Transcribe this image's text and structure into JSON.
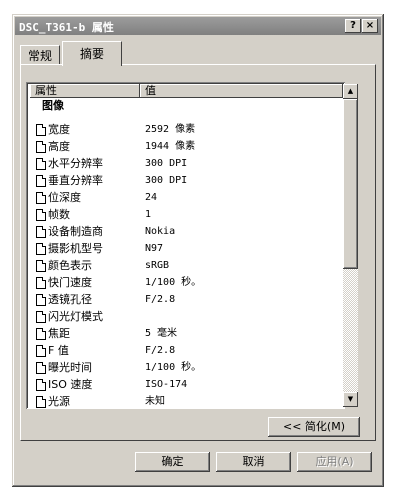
{
  "window": {
    "title": "DSC_T361-b 属性",
    "help_button": "?",
    "close_button": "×"
  },
  "tabs": [
    "常规",
    "摘要"
  ],
  "list": {
    "headers": {
      "property": "属性",
      "value": "值"
    },
    "group": "图像",
    "rows": [
      {
        "label": "宽度",
        "value": "2592 像素"
      },
      {
        "label": "高度",
        "value": "1944 像素"
      },
      {
        "label": "水平分辨率",
        "value": "300 DPI"
      },
      {
        "label": "垂直分辨率",
        "value": "300 DPI"
      },
      {
        "label": "位深度",
        "value": "24"
      },
      {
        "label": "帧数",
        "value": "1"
      },
      {
        "label": "设备制造商",
        "value": "Nokia"
      },
      {
        "label": "摄影机型号",
        "value": "N97"
      },
      {
        "label": "颜色表示",
        "value": "sRGB"
      },
      {
        "label": "快门速度",
        "value": "1/100 秒。"
      },
      {
        "label": "透镜孔径",
        "value": "F/2.8"
      },
      {
        "label": "闪光灯模式",
        "value": ""
      },
      {
        "label": "焦距",
        "value": "5 毫米"
      },
      {
        "label": "F 值",
        "value": "F/2.8"
      },
      {
        "label": "曝光时间",
        "value": "1/100 秒。"
      },
      {
        "label": "ISO 速度",
        "value": "ISO-174"
      },
      {
        "label": "光源",
        "value": "未知"
      }
    ]
  },
  "buttons": {
    "simplify": "<< 简化(M)",
    "ok": "确定",
    "cancel": "取消",
    "apply": "应用(A)"
  },
  "icons": [
    "document-icon",
    "scroll-up-icon",
    "scroll-down-icon"
  ]
}
